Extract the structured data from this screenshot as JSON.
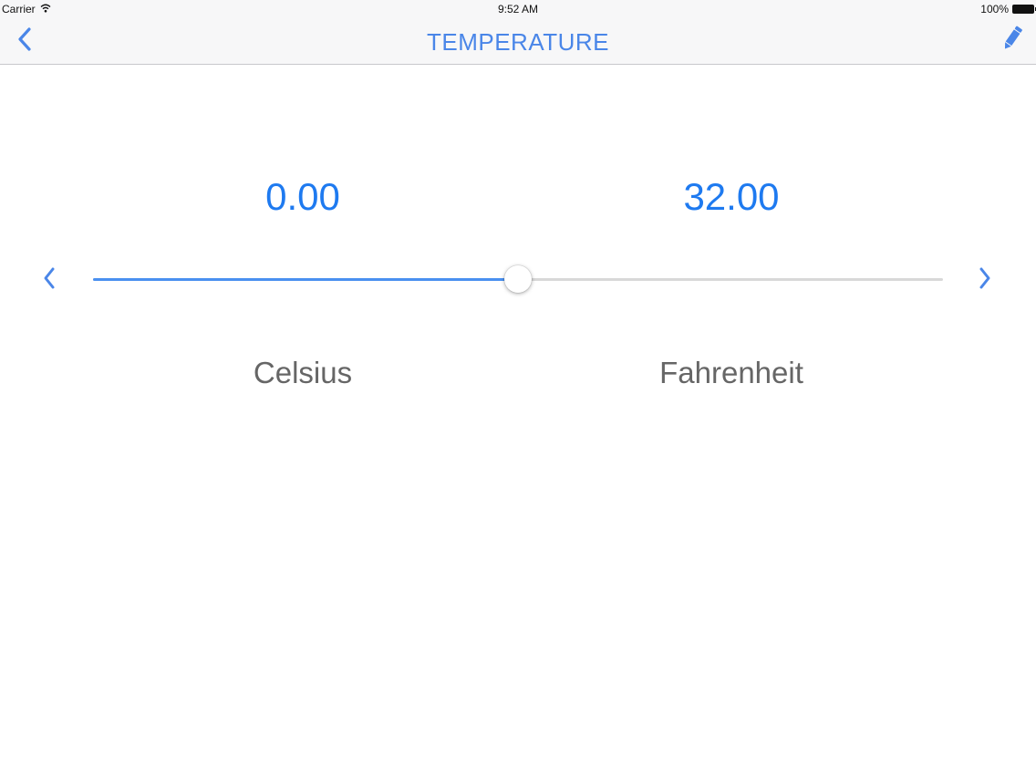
{
  "status_bar": {
    "carrier": "Carrier",
    "time": "9:52 AM",
    "battery": "100%"
  },
  "nav": {
    "title": "TEMPERATURE",
    "back_icon": "chevron-left-icon",
    "edit_icon": "pencil-icon"
  },
  "converter": {
    "left_value": "0.00",
    "right_value": "32.00",
    "left_unit": "Celsius",
    "right_unit": "Fahrenheit",
    "slider_fraction": 0.5
  },
  "colors": {
    "accent": "#1e7af0",
    "nav_tint": "#4a86e8",
    "label": "#666666",
    "track": "#d8d8d8"
  }
}
